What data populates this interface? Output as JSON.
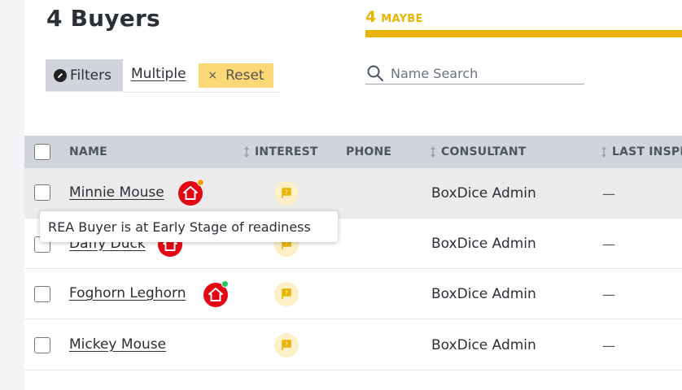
{
  "header": {
    "title": "4 Buyers"
  },
  "stage": {
    "count": "4",
    "label": "MAYBE",
    "color": "#eab308"
  },
  "filters": {
    "filters_label": "Filters",
    "multiple_label": "Multiple",
    "reset_label": "Reset",
    "reset_icon": "×"
  },
  "search": {
    "placeholder": "Name Search",
    "value": ""
  },
  "table": {
    "columns": [
      "NAME",
      "INTEREST",
      "PHONE",
      "CONSULTANT",
      "LAST INSPE"
    ],
    "rows": [
      {
        "name": "Minnie Mouse",
        "rea_badge": true,
        "status_dot_color": "#f59e0b",
        "consultant": "BoxDice Admin",
        "last_inspection": "—"
      },
      {
        "name": "Daffy Duck",
        "rea_badge": true,
        "status_dot_color": "",
        "consultant": "BoxDice Admin",
        "last_inspection": "—"
      },
      {
        "name": "Foghorn Leghorn",
        "rea_badge": true,
        "status_dot_color": "#22c55e",
        "consultant": "BoxDice Admin",
        "last_inspection": "—"
      },
      {
        "name": "Mickey Mouse",
        "rea_badge": false,
        "status_dot_color": "",
        "consultant": "BoxDice Admin",
        "last_inspection": "—"
      }
    ]
  },
  "tooltip": {
    "text": "REA Buyer is at Early Stage of readiness"
  },
  "colors": {
    "rea_red": "#e30613",
    "interest_flag": "#eab308",
    "accent": "#eab308"
  },
  "icons": [
    "edit-icon",
    "search-icon",
    "sort-icon",
    "rea-house-icon",
    "flag-icon",
    "close-icon"
  ]
}
